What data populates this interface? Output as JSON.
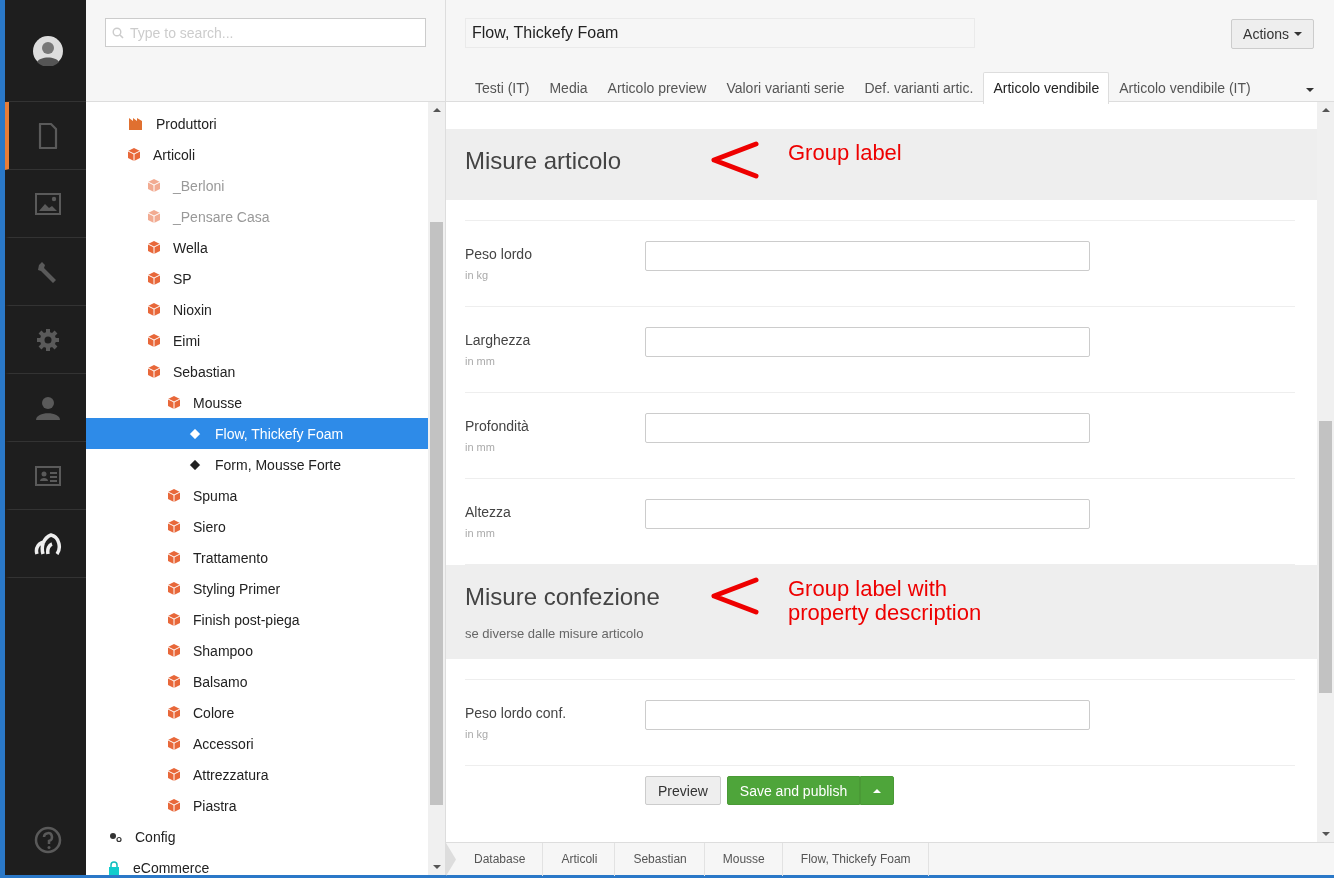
{
  "nav": [
    {
      "kind": "avatar",
      "selected": false
    },
    {
      "kind": "document",
      "selected": true
    },
    {
      "kind": "image",
      "selected": false
    },
    {
      "kind": "wrench",
      "selected": false
    },
    {
      "kind": "gear",
      "selected": false
    },
    {
      "kind": "user",
      "selected": false
    },
    {
      "kind": "card",
      "selected": false
    },
    {
      "kind": "logo",
      "selected": false
    },
    {
      "kind": "help",
      "selected": false
    }
  ],
  "tree": {
    "search": {
      "placeholder": "Type to search..."
    },
    "items": [
      {
        "children": [
          {
            "label": "Produttori",
            "kind": "factory",
            "published": true,
            "selected": false
          },
          {
            "label": "Articoli",
            "kind": "box",
            "published": true,
            "selected": false,
            "children": [
              {
                "label": "_Berloni",
                "kind": "box",
                "published": false,
                "selected": false
              },
              {
                "label": "_Pensare Casa",
                "kind": "box",
                "published": false,
                "selected": false
              },
              {
                "label": "Wella",
                "kind": "box",
                "published": true,
                "selected": false
              },
              {
                "label": "SP",
                "kind": "box",
                "published": true,
                "selected": false
              },
              {
                "label": "Nioxin",
                "kind": "box",
                "published": true,
                "selected": false
              },
              {
                "label": "Eimi",
                "kind": "box",
                "published": true,
                "selected": false
              },
              {
                "label": "Sebastian",
                "kind": "box",
                "published": true,
                "selected": false,
                "children": [
                  {
                    "label": "Mousse",
                    "kind": "box",
                    "published": true,
                    "selected": false,
                    "children": [
                      {
                        "label": "Flow, Thickefy Foam",
                        "kind": "object",
                        "published": true,
                        "selected": true
                      },
                      {
                        "label": "Form, Mousse Forte",
                        "kind": "object",
                        "published": true,
                        "selected": false
                      }
                    ]
                  },
                  {
                    "label": "Spuma",
                    "kind": "box",
                    "published": true,
                    "selected": false
                  },
                  {
                    "label": "Siero",
                    "kind": "box",
                    "published": true,
                    "selected": false
                  },
                  {
                    "label": "Trattamento",
                    "kind": "box",
                    "published": true,
                    "selected": false
                  },
                  {
                    "label": "Styling Primer",
                    "kind": "box",
                    "published": true,
                    "selected": false
                  },
                  {
                    "label": "Finish post-piega",
                    "kind": "box",
                    "published": true,
                    "selected": false
                  },
                  {
                    "label": "Shampoo",
                    "kind": "box",
                    "published": true,
                    "selected": false
                  },
                  {
                    "label": "Balsamo",
                    "kind": "box",
                    "published": true,
                    "selected": false
                  },
                  {
                    "label": "Colore",
                    "kind": "box",
                    "published": true,
                    "selected": false
                  },
                  {
                    "label": "Accessori",
                    "kind": "box",
                    "published": true,
                    "selected": false
                  },
                  {
                    "label": "Attrezzatura",
                    "kind": "box",
                    "published": true,
                    "selected": false
                  },
                  {
                    "label": "Piastra",
                    "kind": "box",
                    "published": true,
                    "selected": false
                  }
                ]
              }
            ]
          }
        ]
      },
      {
        "label": "Config",
        "kind": "gears",
        "published": true,
        "selected": false
      },
      {
        "label": "eCommerce",
        "kind": "lock",
        "published": true,
        "selected": false
      }
    ]
  },
  "editor": {
    "title": "Flow, Thickefy Foam",
    "actions": "Actions",
    "tabs": [
      {
        "label": "Testi (IT)",
        "selected": false
      },
      {
        "label": "Media",
        "selected": false
      },
      {
        "label": "Articolo preview",
        "selected": false
      },
      {
        "label": "Valori varianti serie",
        "selected": false
      },
      {
        "label": "Def. varianti artic.",
        "selected": false
      },
      {
        "label": "Articolo vendibile",
        "selected": true
      },
      {
        "label": "Articolo vendibile (IT)",
        "selected": false
      }
    ],
    "groups": [
      {
        "title": "Misure articolo",
        "annotation": "Group label",
        "fields": [
          {
            "label": "Peso lordo",
            "hint": "in kg"
          },
          {
            "label": "Larghezza",
            "hint": "in mm"
          },
          {
            "label": "Profondità",
            "hint": "in mm"
          },
          {
            "label": "Altezza",
            "hint": "in mm"
          }
        ]
      },
      {
        "title": "Misure confezione",
        "description": "se diverse dalle misure articolo",
        "annotation": "Group label with property description",
        "fields": [
          {
            "label": "Peso lordo conf.",
            "hint": "in kg"
          }
        ]
      }
    ],
    "buttons": {
      "preview": "Preview",
      "save": "Save and publish"
    },
    "breadcrumb": [
      "Database",
      "Articoli",
      "Sebastian",
      "Mousse",
      "Flow, Thickefy Foam"
    ]
  }
}
